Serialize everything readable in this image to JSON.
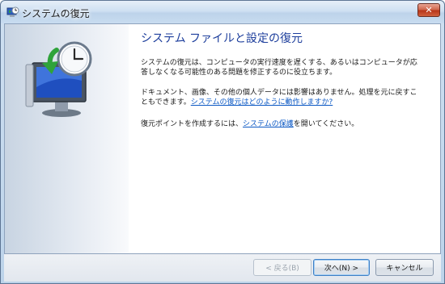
{
  "window": {
    "title": "システムの復元"
  },
  "main": {
    "heading": "システム ファイルと設定の復元",
    "para1": "システムの復元は、コンピュータの実行速度を遅くする、あるいはコンピュータが応答しなくなる可能性のある問題を修正するのに役立ちます。",
    "para2": "ドキュメント、画像、その他の個人データには影響はありません。処理を元に戻すこともできます。",
    "para2_link": "システムの復元はどのように動作しますか?",
    "para3_prefix": "復元ポイントを作成するには、",
    "para3_link": "システムの保護",
    "para3_suffix": "を開いてください。"
  },
  "buttons": {
    "back": "< 戻る(B)",
    "next": "次へ(N) >",
    "cancel": "キャンセル"
  },
  "colors": {
    "heading": "#1d3e9c",
    "link": "#0b58c4"
  },
  "icons": {
    "title": "system-restore-icon",
    "sidebar": "system-restore-illustration"
  }
}
